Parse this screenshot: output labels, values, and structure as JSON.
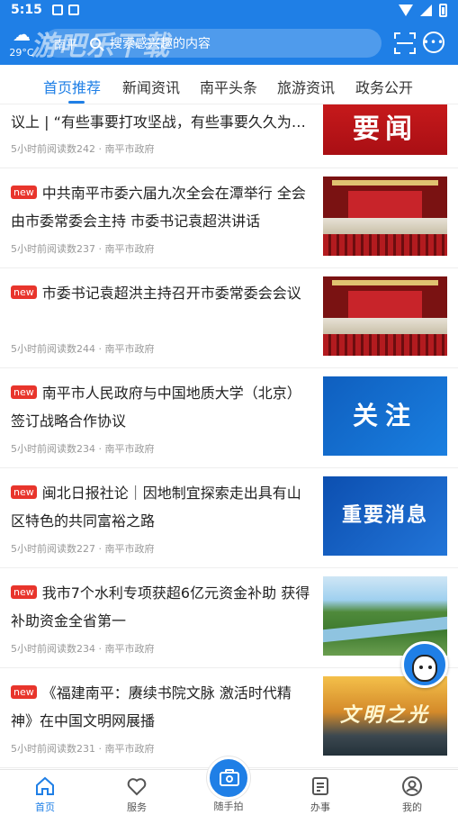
{
  "status_bar": {
    "time": "5:15"
  },
  "header": {
    "temperature": "29°C",
    "watermark": "游吧乐下载",
    "search_city": "南平",
    "search_placeholder": "搜索感兴趣的内容"
  },
  "tabs": [
    {
      "label": "首页推荐",
      "active": true
    },
    {
      "label": "新闻资讯",
      "active": false
    },
    {
      "label": "南平头条",
      "active": false
    },
    {
      "label": "旅游资讯",
      "active": false
    },
    {
      "label": "政务公开",
      "active": false
    }
  ],
  "news": [
    {
      "badge": "",
      "title": "议上 | “有些事要打攻坚战，有些事要久久为…",
      "meta": "5小时前阅读数242 · 南平市政府",
      "thumb_text": "要闻"
    },
    {
      "badge": "new",
      "title": "中共南平市委六届九次全会在潭举行 全会由市委常委会主持 市委书记袁超洪讲话",
      "meta": "5小时前阅读数237 · 南平市政府",
      "thumb_text": ""
    },
    {
      "badge": "new",
      "title": "市委书记袁超洪主持召开市委常委会会议",
      "meta": "5小时前阅读数244 · 南平市政府",
      "thumb_text": ""
    },
    {
      "badge": "new",
      "title": "南平市人民政府与中国地质大学（北京）签订战略合作协议",
      "meta": "5小时前阅读数234 · 南平市政府",
      "thumb_text": "关注"
    },
    {
      "badge": "new",
      "title": "闽北日报社论｜因地制宜探索走出具有山区特色的共同富裕之路",
      "meta": "5小时前阅读数227 · 南平市政府",
      "thumb_text": "重要消息"
    },
    {
      "badge": "new",
      "title": "我市7个水利专项获超6亿元资金补助 获得补助资金全省第一",
      "meta": "5小时前阅读数234 · 南平市政府",
      "thumb_text": ""
    },
    {
      "badge": "new",
      "title": "《福建南平：赓续书院文脉 激活时代精神》在中国文明网展播",
      "meta": "5小时前阅读数231 · 南平市政府",
      "thumb_text": "文明之光"
    }
  ],
  "bottom_nav": {
    "home": "首页",
    "service": "服务",
    "snapshot": "随手拍",
    "affairs": "办事",
    "mine": "我的"
  },
  "colors": {
    "primary": "#1f7fe6",
    "badge": "#e8352c"
  }
}
